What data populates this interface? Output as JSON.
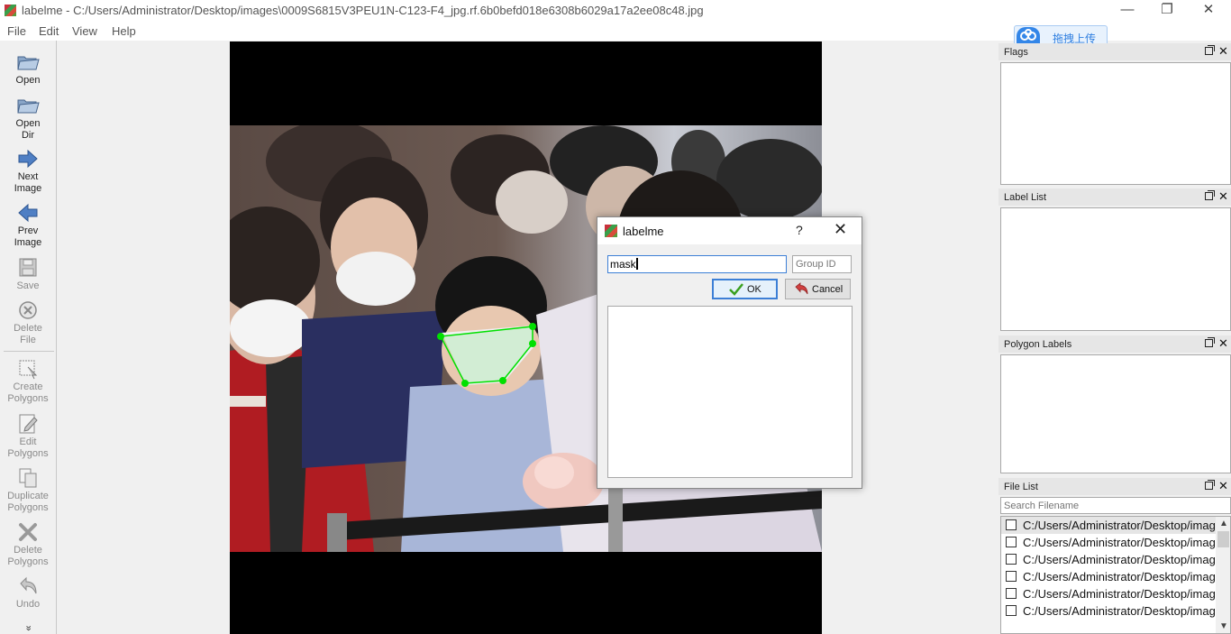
{
  "window": {
    "title": "labelme - C:/Users/Administrator/Desktop/images\\0009S6815V3PEU1N-C123-F4_jpg.rf.6b0befd018e6308b6029a17a2ee08c48.jpg",
    "min": "—",
    "restore": "❐",
    "close": "✕"
  },
  "menu": [
    "File",
    "Edit",
    "View",
    "Help"
  ],
  "toolbar": {
    "open": "Open",
    "open_dir_1": "Open",
    "open_dir_2": "Dir",
    "next_1": "Next",
    "next_2": "Image",
    "prev_1": "Prev",
    "prev_2": "Image",
    "save": "Save",
    "delete_file_1": "Delete",
    "delete_file_2": "File",
    "create_1": "Create",
    "create_2": "Polygons",
    "edit_1": "Edit",
    "edit_2": "Polygons",
    "duplicate_1": "Duplicate",
    "duplicate_2": "Polygons",
    "delete_poly_1": "Delete",
    "delete_poly_2": "Polygons",
    "undo": "Undo",
    "more": "»"
  },
  "cloud_badge": {
    "text": "拖拽上传"
  },
  "docks": {
    "flags": "Flags",
    "label_list": "Label List",
    "polygon_labels": "Polygon Labels",
    "file_list": "File List",
    "close": "✕"
  },
  "file_list": {
    "search_placeholder": "Search Filename",
    "items": [
      "C:/Users/Administrator/Desktop/images",
      "C:/Users/Administrator/Desktop/images",
      "C:/Users/Administrator/Desktop/images",
      "C:/Users/Administrator/Desktop/images",
      "C:/Users/Administrator/Desktop/images",
      "C:/Users/Administrator/Desktop/images"
    ],
    "arrow_up": "▲",
    "arrow_down": "▼",
    "arrow_left": "◀",
    "arrow_right": "▶"
  },
  "dialog": {
    "title": "labelme",
    "help": "?",
    "close": "✕",
    "label_value": "mask",
    "group_placeholder": "Group ID",
    "ok": "OK",
    "cancel": "Cancel"
  },
  "colors": {
    "polygon": "#00e000",
    "accent": "#3c7fd6"
  }
}
